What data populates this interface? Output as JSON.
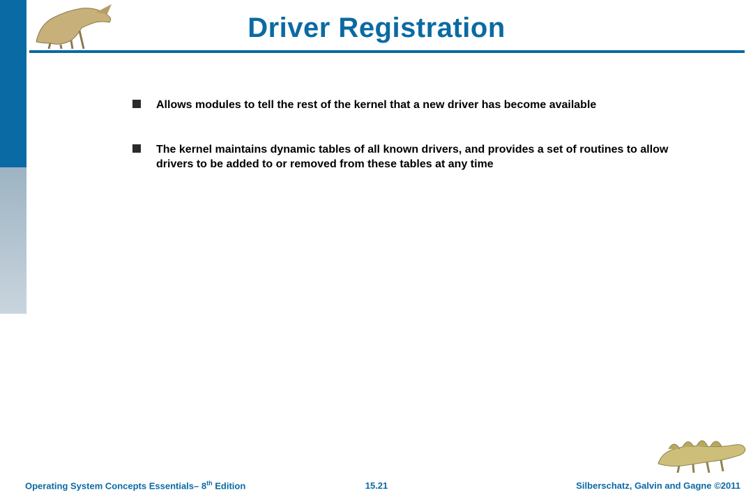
{
  "title": "Driver Registration",
  "bullets": [
    "Allows modules to tell the rest of the kernel that a new driver has become available",
    "The kernel maintains dynamic tables of all known drivers, and provides a set of routines to allow drivers to be added to or removed from these tables at any time"
  ],
  "footer": {
    "left_prefix": "Operating System Concepts Essentials– 8",
    "left_sup": "th",
    "left_suffix": " Edition",
    "center": "15.21",
    "right": "Silberschatz, Galvin and Gagne ©2011"
  },
  "colors": {
    "accent": "#0a6aa3"
  }
}
